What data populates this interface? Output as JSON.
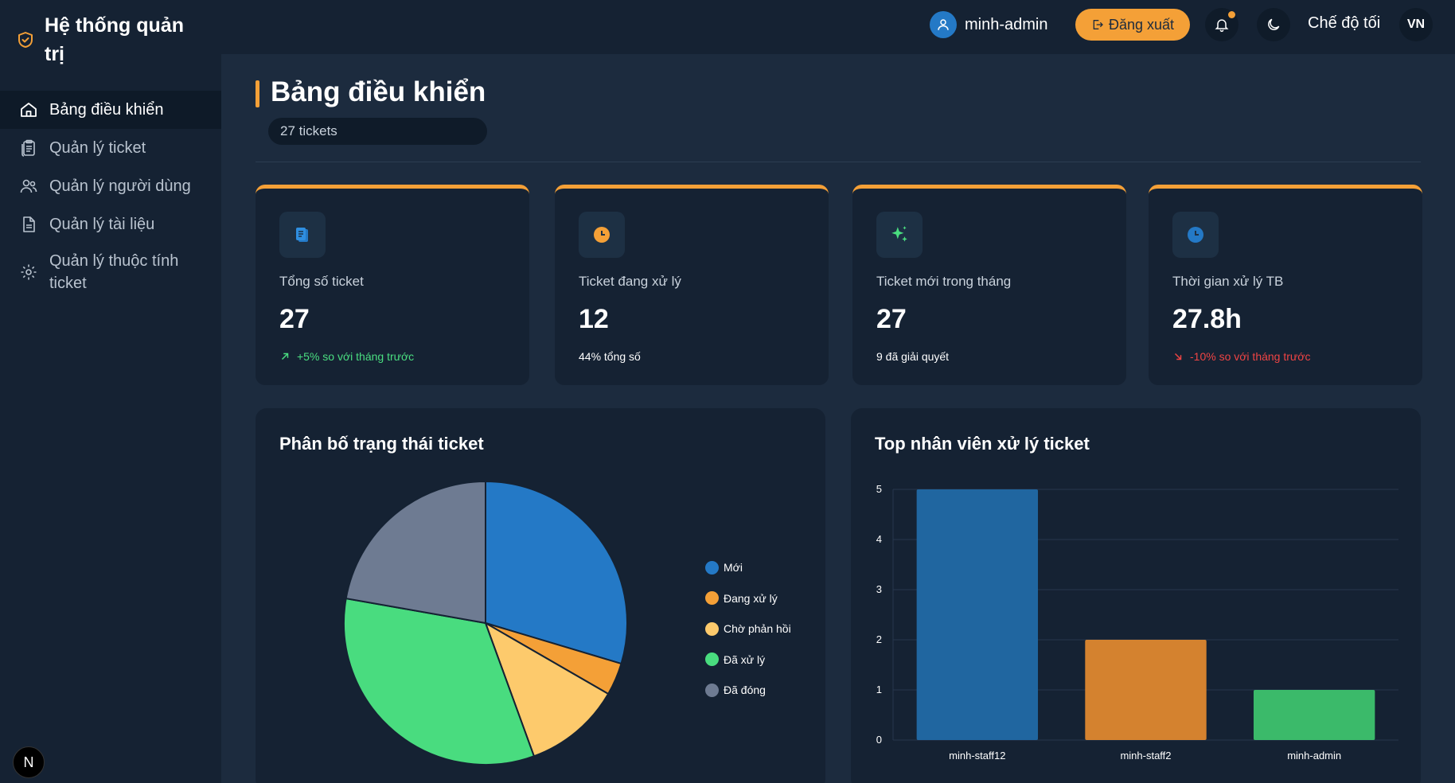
{
  "sidebar": {
    "brand_title": "Hệ thống quản trị",
    "items": [
      {
        "label": "Bảng điều khiển",
        "icon": "home-icon",
        "active": true
      },
      {
        "label": "Quản lý ticket",
        "icon": "clipboard-icon"
      },
      {
        "label": "Quản lý người dùng",
        "icon": "users-icon"
      },
      {
        "label": "Quản lý tài liệu",
        "icon": "document-icon"
      },
      {
        "label": "Quản lý thuộc tính ticket",
        "icon": "gear-icon"
      }
    ],
    "bottom_badge": "N"
  },
  "topbar": {
    "username": "minh-admin",
    "logout_label": "Đăng xuất",
    "dark_mode_label": "Chế độ tối",
    "language": "VN"
  },
  "page": {
    "title": "Bảng điều khiển",
    "ticket_count": "27 tickets"
  },
  "colors": {
    "accent": "#f4a037",
    "positive": "#4ade80",
    "negative": "#ef4444"
  },
  "cards": [
    {
      "label": "Tổng số ticket",
      "value": "27",
      "sub": "+5% so với tháng trước",
      "icon": "clipboard-icon",
      "trend": "up"
    },
    {
      "label": "Ticket đang xử lý",
      "value": "12",
      "sub": "44% tổng số",
      "icon": "clock-icon"
    },
    {
      "label": "Ticket mới trong tháng",
      "value": "27",
      "sub": "9 đã giải quyết",
      "icon": "sparkle-icon"
    },
    {
      "label": "Thời gian xử lý TB",
      "value": "27.8h",
      "sub": "-10% so với tháng trước",
      "icon": "clock-icon",
      "trend": "down"
    }
  ],
  "panels": {
    "status_title": "Phân bố trạng thái ticket",
    "staff_title": "Top nhân viên xử lý ticket"
  },
  "chart_data": [
    {
      "type": "pie",
      "title": "Phân bố trạng thái ticket",
      "legend_position": "right",
      "labels": [
        "Mới",
        "Đang xử lý",
        "Chờ phản hồi",
        "Đã xử lý",
        "Đã đóng"
      ],
      "values": [
        8,
        1,
        3,
        9,
        6
      ],
      "colors": [
        "#2479c6",
        "#f4a037",
        "#fdca6c",
        "#49dc7f",
        "#6e7b92"
      ]
    },
    {
      "type": "bar",
      "title": "Top nhân viên xử lý ticket",
      "categories": [
        "minh-staff12",
        "minh-staff2",
        "minh-admin"
      ],
      "values": [
        5,
        2,
        1
      ],
      "colors": [
        "#2066a0",
        "#d4822f",
        "#3bba6a"
      ],
      "ylim": [
        0,
        5
      ],
      "yticks": [
        0,
        1,
        2,
        3,
        4,
        5
      ],
      "grid": true
    }
  ]
}
